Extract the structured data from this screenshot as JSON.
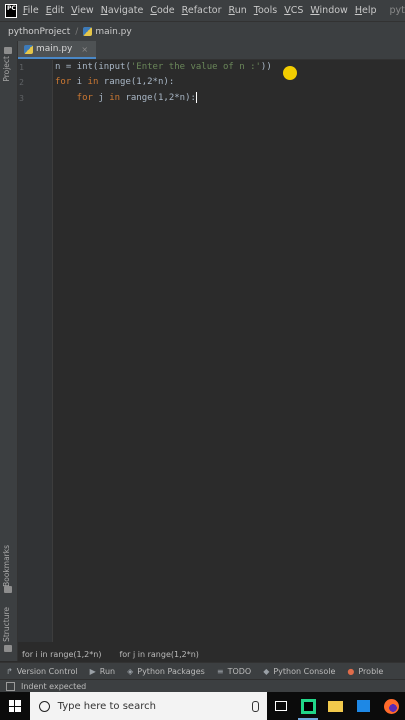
{
  "menubar": {
    "logo": "PC",
    "items": [
      "File",
      "Edit",
      "View",
      "Navigate",
      "Code",
      "Refactor",
      "Run",
      "Tools",
      "VCS",
      "Window",
      "Help"
    ],
    "window_title": "pythonPro"
  },
  "navbar": {
    "project": "pythonProject",
    "separator": "/",
    "file": "main.py"
  },
  "left_strip": {
    "project": "Project",
    "bookmarks": "Bookmarks",
    "structure": "Structure"
  },
  "tabs": [
    {
      "label": "main.py",
      "close": "×"
    }
  ],
  "editor": {
    "line_numbers": [
      "1",
      "2",
      "3"
    ],
    "lines": [
      {
        "a": "n = int(input(",
        "b": "'Enter the value of n :'",
        "c": "))"
      },
      {
        "a": "for",
        "b": " i ",
        "c": "in",
        "d": " range(1,2*n):"
      },
      {
        "a": "    for",
        "b": " j ",
        "c": "in",
        "d": " range(1,2*n):"
      }
    ]
  },
  "breadcrumbs": [
    "for i in range(1,2*n)",
    "for j in range(1,2*n)"
  ],
  "tool_windows": [
    {
      "icon": "↱",
      "label": "Version Control"
    },
    {
      "icon": "▶",
      "label": "Run"
    },
    {
      "icon": "◈",
      "label": "Python Packages"
    },
    {
      "icon": "≡",
      "label": "TODO"
    },
    {
      "icon": "◆",
      "label": "Python Console"
    },
    {
      "icon": "●",
      "label": "Proble"
    }
  ],
  "status": {
    "message": "Indent expected"
  },
  "taskbar": {
    "search_placeholder": "Type here to search"
  },
  "colors": {
    "keyword": "#cc7832",
    "string": "#6a8759",
    "default_text": "#a9b7c6",
    "editor_bg": "#2b2b2b",
    "chrome_bg": "#3c3f41",
    "cursor_highlight": "#f2cd00"
  }
}
